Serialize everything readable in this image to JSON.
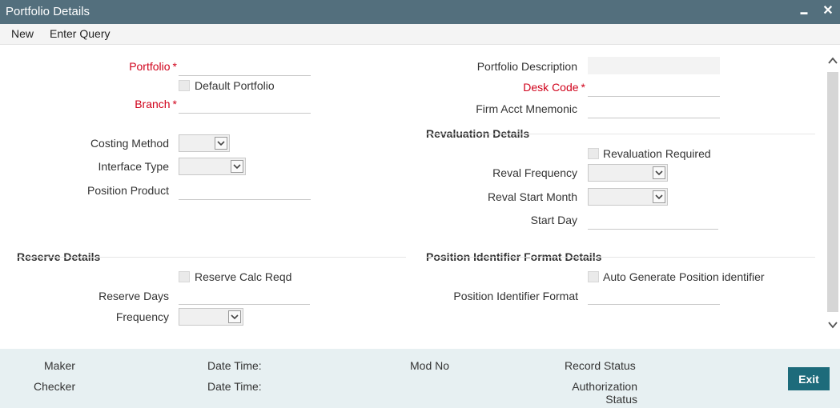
{
  "window": {
    "title": "Portfolio Details",
    "minimize_glyph": "▬",
    "close_glyph": "✕"
  },
  "menu": {
    "new": "New",
    "enter_query": "Enter Query"
  },
  "form": {
    "portfolio_label": "Portfolio",
    "default_portfolio_label": "Default Portfolio",
    "branch_label": "Branch",
    "costing_method_label": "Costing Method",
    "interface_type_label": "Interface Type",
    "position_product_label": "Position Product",
    "portfolio_description_label": "Portfolio Description",
    "desk_code_label": "Desk Code",
    "firm_acct_mnemonic_label": "Firm Acct Mnemonic",
    "required_marker": "*"
  },
  "revaluation": {
    "heading": "Revaluation Details",
    "required_label": "Revaluation Required",
    "frequency_label": "Reval Frequency",
    "start_month_label": "Reval Start Month",
    "start_day_label": "Start Day"
  },
  "reserve": {
    "heading": "Reserve Details",
    "calc_reqd_label": "Reserve Calc Reqd",
    "days_label": "Reserve Days",
    "frequency_label": "Frequency"
  },
  "position_identifier": {
    "heading": "Position Identifier Format Details",
    "auto_generate_label": "Auto Generate Position identifier",
    "format_label": "Position Identifier Format"
  },
  "footer": {
    "maker": "Maker",
    "checker": "Checker",
    "date_time_1": "Date Time:",
    "date_time_2": "Date Time:",
    "mod_no": "Mod No",
    "record_status": "Record Status",
    "authorization_status_line1": "Authorization",
    "authorization_status_line2": "Status",
    "exit": "Exit"
  },
  "icons": {
    "scroll_up": "chevron-up-icon",
    "scroll_down": "chevron-down-icon",
    "dropdown": "chevron-down-icon"
  },
  "colors": {
    "titlebar": "#536f7d",
    "required": "#d0021b",
    "exit_button": "#1d6b7b",
    "footer_bg": "#e7f0f2"
  }
}
